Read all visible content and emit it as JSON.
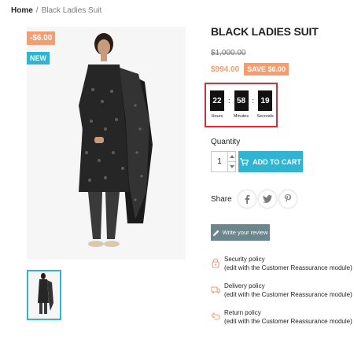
{
  "breadcrumb": {
    "home": "Home",
    "separator": "/",
    "current": "Black Ladies Suit"
  },
  "product": {
    "title": "BLACK LADIES SUIT",
    "old_price": "$1,000.00",
    "price": "$994.00",
    "save_label": "SAVE $6.00",
    "flag_discount": "-$6.00",
    "flag_new": "NEW"
  },
  "countdown": {
    "hours": "22",
    "minutes": "58",
    "seconds": "19",
    "hours_label": "Hours",
    "minutes_label": "Minutes",
    "seconds_label": "Seconds",
    "separator": ":"
  },
  "quantity": {
    "label": "Quantity",
    "value": "1"
  },
  "cart": {
    "label": "ADD TO CART",
    "icon": "cart-icon"
  },
  "share": {
    "label": "Share",
    "networks": [
      "facebook-icon",
      "twitter-icon",
      "pinterest-icon"
    ]
  },
  "review": {
    "label": "Write your review",
    "icon": "pencil-icon"
  },
  "reassurance": [
    {
      "title": "Security policy",
      "note": "(edit with the Customer Reassurance module)",
      "icon": "lock-icon"
    },
    {
      "title": "Delivery policy",
      "note": "(edit with the Customer Reassurance module)",
      "icon": "truck-icon"
    },
    {
      "title": "Return policy",
      "note": "(edit with the Customer Reassurance module)",
      "icon": "return-icon"
    }
  ],
  "colors": {
    "accent": "#2fb5d2",
    "discount": "#f39d72",
    "review": "#6c868e",
    "highlight_border": "#e02a35"
  }
}
